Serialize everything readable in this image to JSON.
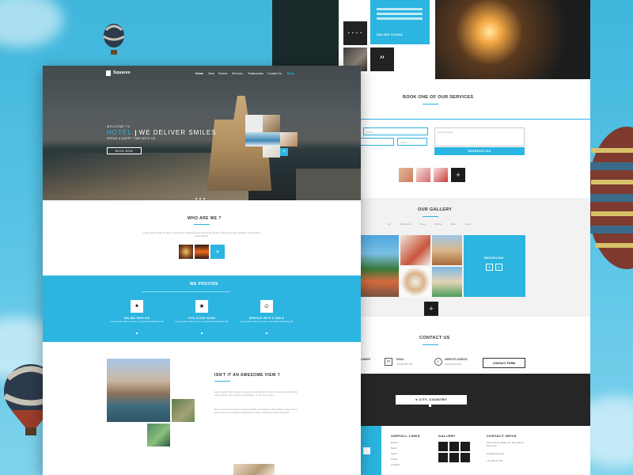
{
  "colors": {
    "accent": "#2bb5e0",
    "dark": "#1c1c1c",
    "sky": "#3fb6dc"
  },
  "left_page": {
    "nav": {
      "logo": "Squares",
      "items": [
        "Home",
        "View",
        "Rooms",
        "Services",
        "Testimonials",
        "Contact Us",
        "Book"
      ]
    },
    "hero": {
      "welcome": "WELCOME TO",
      "title_accent": "HOTEL",
      "title_rest": "WE DELIVER SMILES",
      "subtitle": "SPEND A HAPPY TIME WITH US",
      "button": "BOOK NOW"
    },
    "who": {
      "title": "WHO ARE WE ?",
      "text": "Lorem ipsum dolor sit amet, consectetur adipiscing elit. Donec elementum tellus quis dolor gravida, sed tincidunt nulla facilisis.",
      "plus": "+"
    },
    "provide": {
      "title": "WE PROVIDE",
      "services": [
        {
          "title": "ONLINE SERVICE",
          "icon": "puzzle-icon",
          "glyph": "✦",
          "text": "Lorem ipsum dolor sit amet, consectetur adipiscing elit."
        },
        {
          "title": "FIVE STARS BANK",
          "icon": "star-icon",
          "glyph": "★",
          "text": "Lorem ipsum dolor sit amet, consectetur adipiscing elit."
        },
        {
          "title": "SERVICE WITH A SMILE",
          "icon": "smile-icon",
          "glyph": "☺",
          "text": "Lorem ipsum dolor sit amet, consectetur adipiscing elit."
        }
      ]
    },
    "awesome": {
      "title": "ISN'T IT AN AWESOME VIEW ?",
      "para1": "Lorem ipsum dolor sit amet, consectetur adipiscing elit. Donec elementum tellus quis dolor gravida, sed tincidunt nulla facilisis. Ut nec tortor augue.",
      "para2": "Donec elementum tellus quis dolor gravida, sed tincidunt nulla facilisis. Lorem ipsum dolor sit amet, consectetur adipiscing elit. Donec elementum tellus quis dolor."
    }
  },
  "right_page": {
    "testimonial": {
      "author": "SALMA DIANA",
      "quote_glyph": "”"
    },
    "book": {
      "title": "BOOK ONE OF OUR SERVICES",
      "fields": [
        "Name",
        "Email",
        "Phone",
        "Room"
      ],
      "message_placeholder": "Special Needs",
      "button": "RESERVATION",
      "plus": "+"
    },
    "gallery": {
      "title": "OUR GALLERY",
      "filters": [
        "All",
        "Bedrooms",
        "Views",
        "Kitchen",
        "Bars",
        "Pools"
      ],
      "feature_label": "BEDROOM",
      "plus": "+"
    },
    "contact": {
      "title": "CONTACT US",
      "number_label": "NUMBER",
      "email_label": "EMAIL",
      "email_value": "info@mail.com",
      "website_label": "WEBSITE ADRESS",
      "website_value": "www.hotel.com",
      "form_button": "CONTACT FORM",
      "map_label": "CITY, COUNTRY"
    },
    "footer": {
      "useful_title": "USEFULL LINKS",
      "useful_links": [
        "Rooms",
        "Book",
        "Views",
        "Travel",
        "Contacts"
      ],
      "gallery_title": "GALLERY",
      "contact_title": "CONTACT INFOS",
      "contact_lines": [
        "123, Dummy Road, St. John Street, New York",
        "email@mail.com",
        "+9 1234 5 5 56"
      ]
    }
  }
}
